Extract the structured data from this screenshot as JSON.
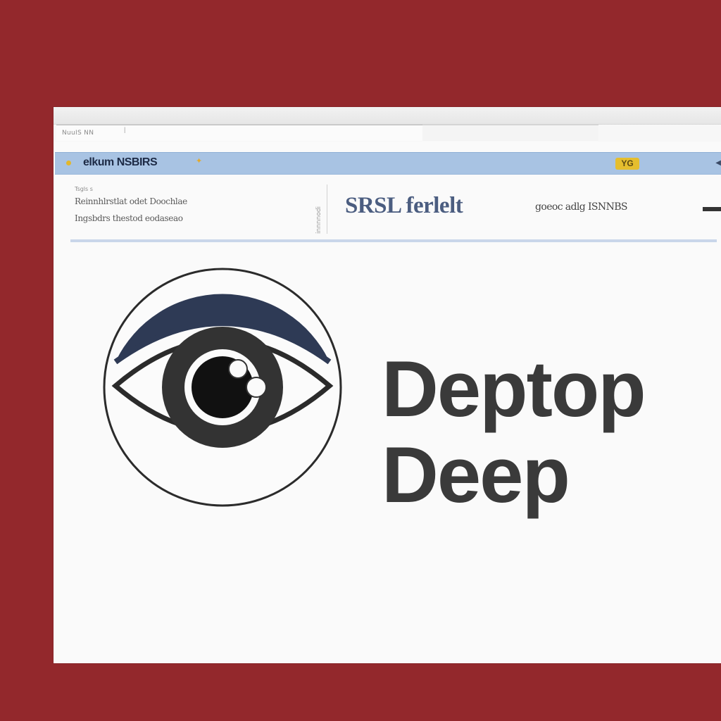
{
  "theme": {
    "background": "#93282c",
    "window": "#fafafa",
    "navbar": "#a8c3e3",
    "heading_blue": "#4b5d80",
    "logo_navy": "#2e3a55",
    "text_dark": "#3a3a3a",
    "badge_yellow": "#e5be2e"
  },
  "window": {
    "tab_label": "NuuIS NN",
    "tab_icon": "seal-icon"
  },
  "navbar": {
    "title": "elkum NSBIRS",
    "badge": "YG",
    "icons": [
      "bullet-icon",
      "star-icon",
      "menu-arrow-icon"
    ]
  },
  "info": {
    "small_label": "Tsgls s",
    "line1": "Reinnhlrstlat odet Doochlae",
    "line2": "Ingsbdrs thestod eodaseao",
    "vertical_text": "innnnodi",
    "heading": "SRSL ferlelt",
    "right_text": "goeoc adlg ISNNBS"
  },
  "brand": {
    "line1": "Deptop",
    "line2": "Deep",
    "logo_icon": "eye-icon"
  }
}
